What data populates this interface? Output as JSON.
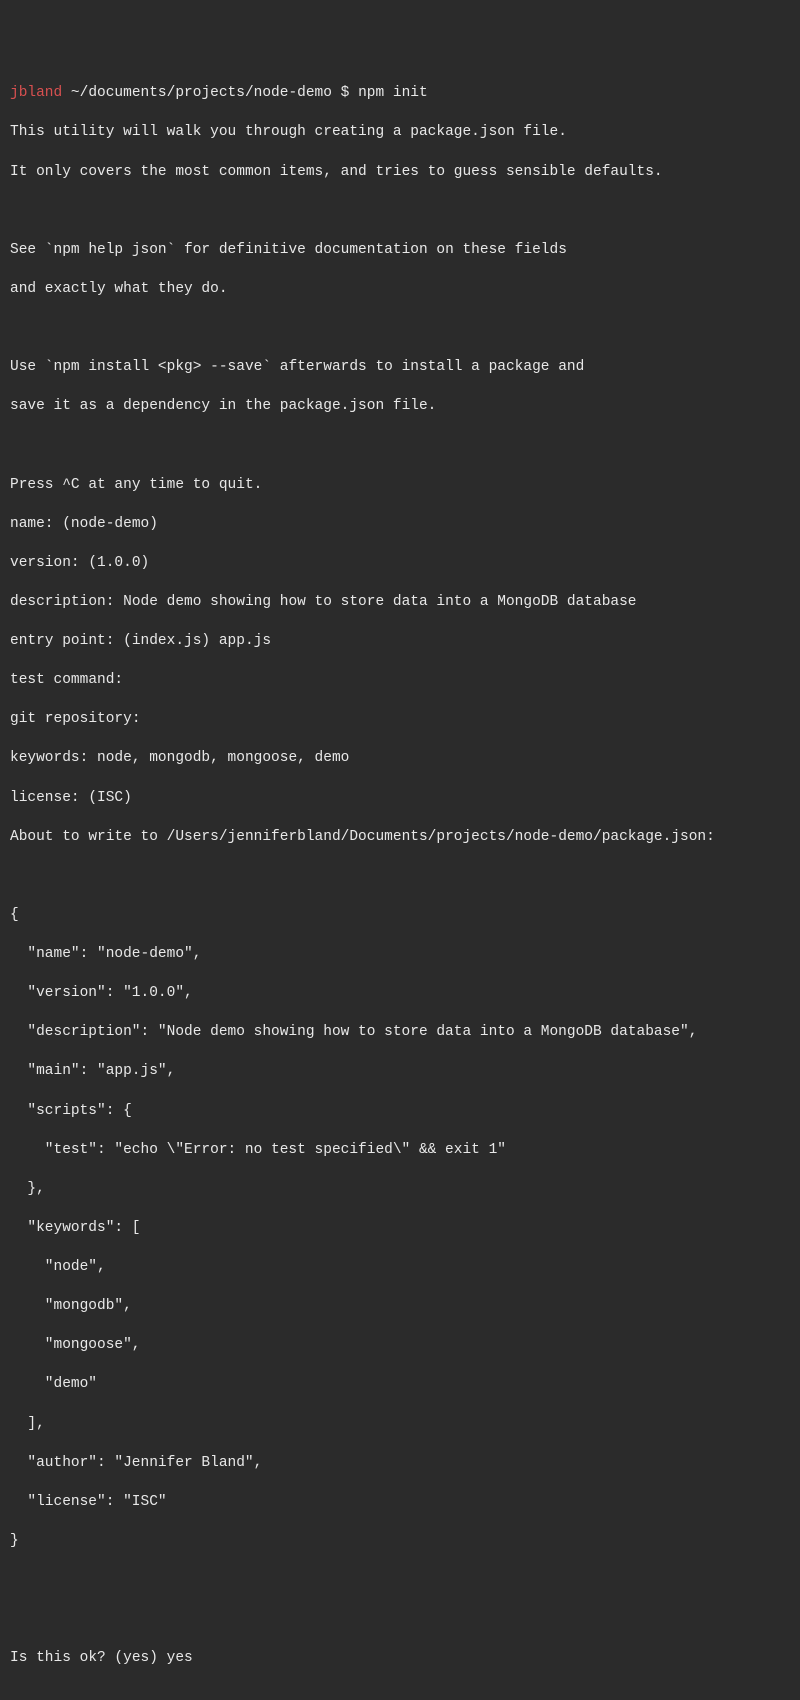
{
  "prompt": {
    "user": "jbland",
    "path": "~/documents/projects/node-demo",
    "symbol": "$",
    "command": "npm init"
  },
  "intro": {
    "l1": "This utility will walk you through creating a package.json file.",
    "l2": "It only covers the most common items, and tries to guess sensible defaults.",
    "l3": "See `npm help json` for definitive documentation on these fields",
    "l4": "and exactly what they do.",
    "l5": "Use `npm install <pkg> --save` afterwards to install a package and",
    "l6": "save it as a dependency in the package.json file.",
    "l7": "Press ^C at any time to quit."
  },
  "fields": {
    "name": "name: (node-demo)",
    "version": "version: (1.0.0)",
    "description": "description: Node demo showing how to store data into a MongoDB database",
    "entry": "entry point: (index.js) app.js",
    "test": "test command:",
    "git": "git repository:",
    "keywords": "keywords: node, mongodb, mongoose, demo",
    "license": "license: (ISC)",
    "about": "About to write to /Users/jenniferbland/Documents/projects/node-demo/package.json:"
  },
  "pkg": {
    "open": "{",
    "name": "\"name\": \"node-demo\",",
    "version": "\"version\": \"1.0.0\",",
    "description": "\"description\": \"Node demo showing how to store data into a MongoDB database\",",
    "main": "\"main\": \"app.js\",",
    "scripts_open": "\"scripts\": {",
    "scripts_test": "\"test\": \"echo \\\"Error: no test specified\\\" && exit 1\"",
    "scripts_close": "},",
    "keywords_open": "\"keywords\": [",
    "kw0": "\"node\",",
    "kw1": "\"mongodb\",",
    "kw2": "\"mongoose\",",
    "kw3": "\"demo\"",
    "keywords_close": "],",
    "author": "\"author\": \"Jennifer Bland\",",
    "license": "\"license\": \"ISC\"",
    "close": "}"
  },
  "confirm": {
    "prompt": "Is this ok? (yes) yes"
  }
}
